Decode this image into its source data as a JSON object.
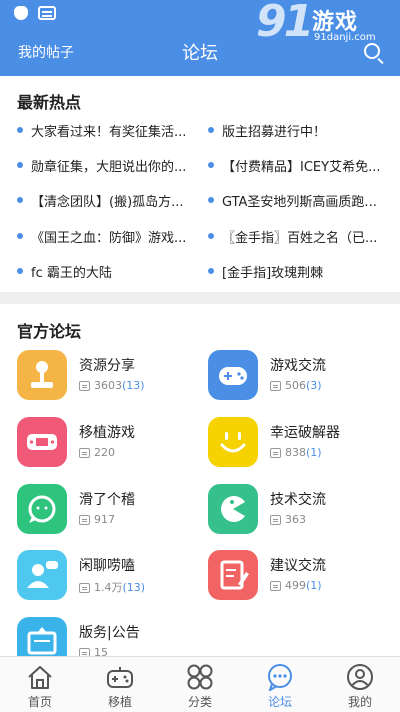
{
  "header": {
    "left_link": "我的帖子",
    "title": "论坛"
  },
  "watermark": {
    "logo_number": "91",
    "logo_text": "游戏",
    "url": "91danji.com"
  },
  "hot": {
    "title": "最新热点",
    "items": [
      "大家看过来！有奖征集活...",
      "版主招募进行中！",
      "勋章征集，大胆说出你的...",
      "【付费精品】ICEY艾希免...",
      "【清念团队】(搬)孤岛方...",
      "GTA圣安地列斯高画质跑...",
      "《国王之血：防御》游戏...",
      "〖金手指〗百姓之名（已...",
      "fc 霸王的大陆",
      "[金手指]玫瑰荆棘"
    ]
  },
  "forums": {
    "title": "官方论坛",
    "items": [
      {
        "name": "资源分享",
        "count": "3603",
        "new": "(13)",
        "color": "#f5b546"
      },
      {
        "name": "游戏交流",
        "count": "506",
        "new": "(3)",
        "color": "#4a8ee6"
      },
      {
        "name": "移植游戏",
        "count": "220",
        "new": "",
        "color": "#f05a78"
      },
      {
        "name": "幸运破解器",
        "count": "838",
        "new": "(1)",
        "color": "#f5d200"
      },
      {
        "name": "滑了个稽",
        "count": "917",
        "new": "",
        "color": "#2ec47e"
      },
      {
        "name": "技术交流",
        "count": "363",
        "new": "",
        "color": "#36c08c"
      },
      {
        "name": "闲聊唠嗑",
        "count": "1.4万",
        "new": "(13)",
        "color": "#4fc8ef"
      },
      {
        "name": "建议交流",
        "count": "499",
        "new": "(1)",
        "color": "#f26464"
      },
      {
        "name": "版务|公告",
        "count": "15",
        "new": "",
        "color": "#3ab2ea"
      }
    ]
  },
  "tabs": [
    {
      "label": "首页",
      "icon": "home-icon"
    },
    {
      "label": "移植",
      "icon": "gamepad-icon"
    },
    {
      "label": "分类",
      "icon": "category-icon"
    },
    {
      "label": "论坛",
      "icon": "forum-icon",
      "active": true
    },
    {
      "label": "我的",
      "icon": "profile-icon"
    }
  ],
  "colors": {
    "accent": "#4a8ee6",
    "tab_inactive": "#555555"
  }
}
